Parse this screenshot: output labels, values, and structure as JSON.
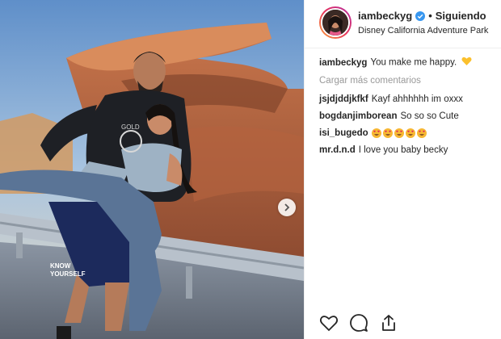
{
  "post": {
    "username": "iambeckyg",
    "follow_label": "Siguiendo",
    "separator": "•",
    "location": "Disney California Adventure Park"
  },
  "photo": {
    "shorts_text_line1": "KNOW",
    "shorts_text_line2": "YOURSELF",
    "shirt_text": "GOLD"
  },
  "caption": {
    "username": "iambeckyg",
    "text": "You make me happy."
  },
  "load_more_label": "Cargar más comentarios",
  "comments": [
    {
      "username": "jsjdjddjkfkf",
      "text": "Kayf ahhhhhh im oxxx"
    },
    {
      "username": "bogdanjimborean",
      "text": "So so so Cute"
    },
    {
      "username": "isi_bugedo",
      "text": "",
      "emoji_count": 5
    },
    {
      "username": "mr.d.n.d",
      "text": "I love you baby becky"
    }
  ],
  "icons": [
    "verified-badge-icon",
    "yellow-heart-icon",
    "heart-eyes-emoji-icon",
    "carousel-next-icon",
    "like-heart-icon",
    "comment-icon",
    "share-icon"
  ],
  "colors": {
    "verified": "#3897f0",
    "yellow_heart": "#fbc02d",
    "muted": "#999999",
    "text": "#262626"
  }
}
